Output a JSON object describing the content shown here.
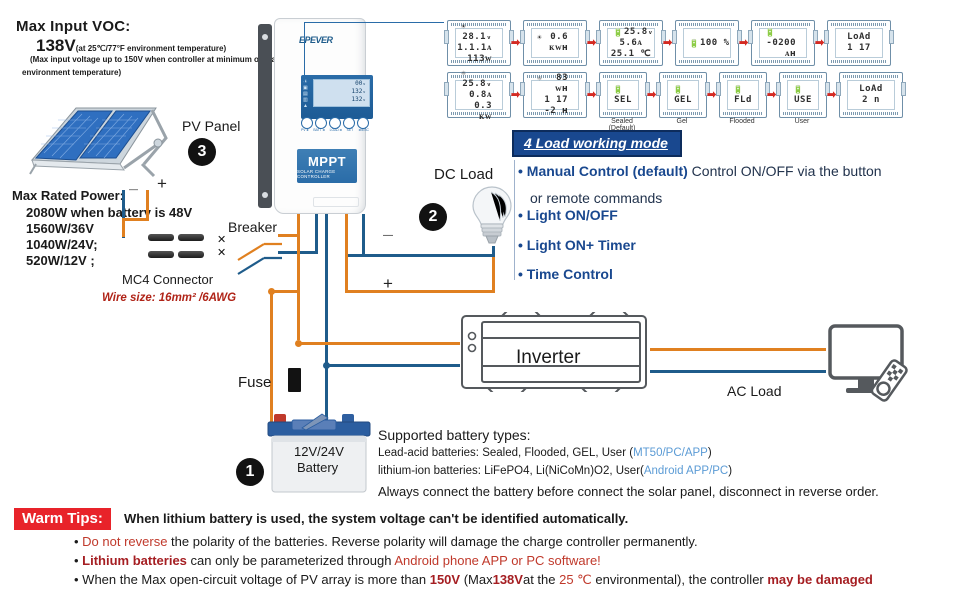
{
  "specs": {
    "voc_title": "Max Input VOC:",
    "voc_value": "138V",
    "voc_value_sub": "(at 25℃/77°F environment temperature)",
    "voc_note_line1": "(Max input voltage up to 150V when controller at minimum operating",
    "voc_note_line2": "environment temperature)",
    "power_title": "Max Rated Power:",
    "power_lines": [
      "2080W when battery is 48V",
      "1560W/36V",
      "1040W/24V;",
      "520W/12V ;"
    ]
  },
  "labels": {
    "pv_panel": "PV Panel",
    "pv_badge": "3",
    "mc4": "MC4 Connector",
    "wire_size": "Wire size: 16mm² /6AWG",
    "breaker": "Breaker",
    "fuse": "Fuse",
    "dc_load": "DC Load",
    "dc_badge": "2",
    "battery_badge": "1",
    "inverter": "Inverter",
    "ac_load": "AC Load",
    "battery_line1": "12V/24V",
    "battery_line2": "Battery",
    "plus": "+",
    "minus": "—"
  },
  "controller": {
    "brand": "EPEVER",
    "model_big": "MPPT",
    "model_small": "SOLAR CHARGE CONTROLLER",
    "lcd_rows": [
      "00ᵥ",
      "132ᵥ",
      "132ᵥ"
    ],
    "button_labels": [
      "PV◄",
      "BATT◄",
      "LOAD◄",
      "SET",
      "◄/ESC"
    ]
  },
  "load_modes": {
    "heading": "4 Load working mode",
    "items": [
      {
        "bold": "Manual Control (default)",
        "rest": " Control ON/OFF  via the button"
      },
      {
        "bold": "Light ON/OFF",
        "rest": ""
      },
      {
        "bold": "Light ON+ Timer",
        "rest": ""
      },
      {
        "bold": "Time Control",
        "rest": ""
      }
    ],
    "sub_line": "or remote commands"
  },
  "battery_info": {
    "title": "Supported battery types:",
    "lead_acid_prefix": "Lead-acid batteries: Sealed, Flooded, GEL, User (",
    "lead_acid_link": "MT50/PC/APP",
    "lead_acid_suffix": ")",
    "lithium_prefix": "lithium-ion batteries: LiFePO4, Li(NiCoMn)O2, User(",
    "lithium_link": "Android APP/PC",
    "lithium_suffix": ")",
    "always": "Always connect the battery before connect the solar panel, disconnect in reverse order."
  },
  "warm_tips": {
    "badge": "Warm Tips:",
    "main": "When lithium battery is used, the system voltage can't be identified automatically.",
    "tip1_red": "Do not reverse",
    "tip1_rest": " the polarity of the batteries. Reverse polarity will damage the charge controller permanently.",
    "tip2_red": "Lithium batteries",
    "tip2_mid": " can only be parameterized through ",
    "tip2_red2": "Android phone APP or PC software!",
    "tip3_a": "When the Max open-circuit voltage of PV array is more than ",
    "tip3_v1": "150V",
    "tip3_b": " (Max",
    "tip3_v2": "138V",
    "tip3_c": "at the ",
    "tip3_v3": "25 ℃",
    "tip3_d": " environmental), the controller ",
    "tip3_e": "may be damaged"
  },
  "lcd_screens": {
    "row1": [
      {
        "name": "pv-voltage-screen",
        "icon": "☀",
        "lines": [
          "28.1ᵥ",
          "1.1.1ᴀ",
          "113ᴡ"
        ],
        "center": false
      },
      {
        "name": "pv-power-screen",
        "icon": "☀",
        "lines": [
          "0.6 ᴋᴡʜ"
        ],
        "center": false
      },
      {
        "name": "battery-status-screen",
        "icon": "🔋",
        "lines": [
          "25.8ᵥ",
          "5.6ᴀ",
          "25.1 ℃"
        ],
        "center": true
      },
      {
        "name": "battery-soc-screen",
        "icon": "🔋",
        "lines": [
          "100 %"
        ],
        "center": true
      },
      {
        "name": "battery-capacity-screen",
        "icon": "🔋",
        "lines": [
          "-0200 ᴀʜ"
        ],
        "center": false
      },
      {
        "name": "load-mode-1-screen",
        "icon": "",
        "lines": [
          "LoAd",
          "1 17"
        ],
        "center": true
      }
    ],
    "row2": [
      {
        "name": "load-voltage-screen",
        "icon": "☼",
        "lines": [
          "25.8ᵥ",
          "0.8ᴀ",
          "0.3 ᴋᴡ"
        ],
        "center": false
      },
      {
        "name": "load-energy-screen",
        "icon": "☼",
        "lines": [
          "83 ᴡʜ",
          "1 17",
          "-2 ʜ"
        ],
        "center": false
      },
      {
        "name": "battery-type-sealed-screen",
        "icon": "🔋",
        "lines": [
          "SEL"
        ],
        "center": true,
        "caption": "Sealed (Default)"
      },
      {
        "name": "battery-type-gel-screen",
        "icon": "🔋",
        "lines": [
          "GEL"
        ],
        "center": true,
        "caption": "Gel"
      },
      {
        "name": "battery-type-flooded-screen",
        "icon": "🔋",
        "lines": [
          "FLd"
        ],
        "center": true,
        "caption": "Flooded"
      },
      {
        "name": "battery-type-user-screen",
        "icon": "🔋",
        "lines": [
          "USE"
        ],
        "center": true,
        "caption": "User"
      },
      {
        "name": "load-mode-2-screen",
        "icon": "",
        "lines": [
          "LoAd",
          "2 n"
        ],
        "center": true
      }
    ]
  },
  "colors": {
    "wire_positive": "#e08020",
    "wire_negative": "#1f5c8b",
    "accent_blue": "#19488f",
    "warn_red": "#e8232a",
    "link_blue": "#5b9bd5"
  }
}
